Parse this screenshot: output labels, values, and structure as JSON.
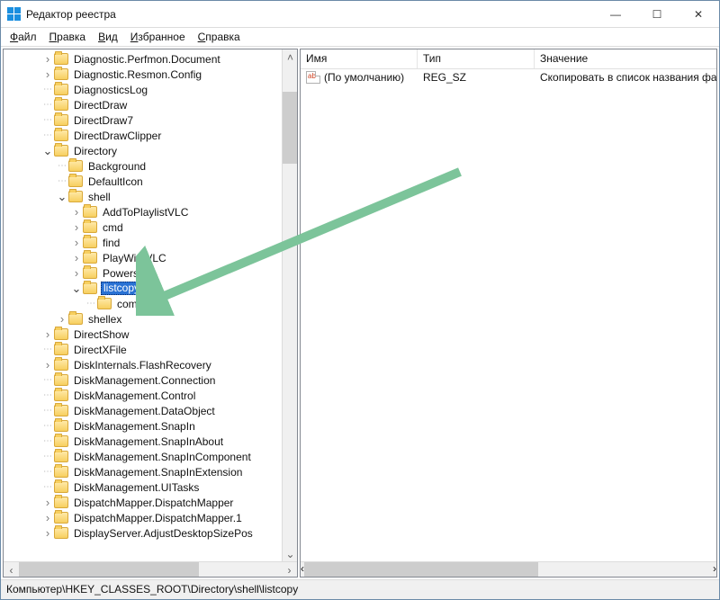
{
  "window": {
    "title": "Редактор реестра",
    "controls": {
      "min": "—",
      "max": "☐",
      "close": "✕"
    }
  },
  "menu": {
    "file": {
      "ul": "Ф",
      "rest": "айл"
    },
    "edit": {
      "ul": "П",
      "rest": "равка"
    },
    "view": {
      "ul": "В",
      "rest": "ид"
    },
    "fav": {
      "ul": "И",
      "rest": "збранное"
    },
    "help": {
      "ul": "С",
      "rest": "правка"
    }
  },
  "tree": {
    "items": [
      {
        "depth": 2,
        "arrow": "›",
        "label": "Diagnostic.Perfmon.Document"
      },
      {
        "depth": 2,
        "arrow": "›",
        "label": "Diagnostic.Resmon.Config"
      },
      {
        "depth": 2,
        "arrow": "",
        "label": "DiagnosticsLog"
      },
      {
        "depth": 2,
        "arrow": "",
        "label": "DirectDraw"
      },
      {
        "depth": 2,
        "arrow": "",
        "label": "DirectDraw7"
      },
      {
        "depth": 2,
        "arrow": "",
        "label": "DirectDrawClipper"
      },
      {
        "depth": 2,
        "arrow": "v",
        "label": "Directory"
      },
      {
        "depth": 3,
        "arrow": "",
        "label": "Background"
      },
      {
        "depth": 3,
        "arrow": "",
        "label": "DefaultIcon"
      },
      {
        "depth": 3,
        "arrow": "v",
        "label": "shell"
      },
      {
        "depth": 4,
        "arrow": "›",
        "label": "AddToPlaylistVLC"
      },
      {
        "depth": 4,
        "arrow": "›",
        "label": "cmd"
      },
      {
        "depth": 4,
        "arrow": "›",
        "label": "find"
      },
      {
        "depth": 4,
        "arrow": "›",
        "label": "PlayWithVLC"
      },
      {
        "depth": 4,
        "arrow": "›",
        "label": "Powershell"
      },
      {
        "depth": 4,
        "arrow": "v",
        "label": "listcopy",
        "selected": true
      },
      {
        "depth": 5,
        "arrow": "",
        "label": "command"
      },
      {
        "depth": 3,
        "arrow": "›",
        "label": "shellex"
      },
      {
        "depth": 2,
        "arrow": "›",
        "label": "DirectShow"
      },
      {
        "depth": 2,
        "arrow": "",
        "label": "DirectXFile"
      },
      {
        "depth": 2,
        "arrow": "›",
        "label": "DiskInternals.FlashRecovery"
      },
      {
        "depth": 2,
        "arrow": "",
        "label": "DiskManagement.Connection"
      },
      {
        "depth": 2,
        "arrow": "",
        "label": "DiskManagement.Control"
      },
      {
        "depth": 2,
        "arrow": "",
        "label": "DiskManagement.DataObject"
      },
      {
        "depth": 2,
        "arrow": "",
        "label": "DiskManagement.SnapIn"
      },
      {
        "depth": 2,
        "arrow": "",
        "label": "DiskManagement.SnapInAbout"
      },
      {
        "depth": 2,
        "arrow": "",
        "label": "DiskManagement.SnapInComponent"
      },
      {
        "depth": 2,
        "arrow": "",
        "label": "DiskManagement.SnapInExtension"
      },
      {
        "depth": 2,
        "arrow": "",
        "label": "DiskManagement.UITasks"
      },
      {
        "depth": 2,
        "arrow": "›",
        "label": "DispatchMapper.DispatchMapper"
      },
      {
        "depth": 2,
        "arrow": "›",
        "label": "DispatchMapper.DispatchMapper.1"
      },
      {
        "depth": 2,
        "arrow": "›",
        "label": "DisplayServer.AdjustDesktopSizePos"
      }
    ]
  },
  "list": {
    "columns": {
      "name": "Имя",
      "type": "Тип",
      "value": "Значение"
    },
    "colWidths": {
      "name": 130,
      "type": 130,
      "value": 200
    },
    "rows": [
      {
        "name": "(По умолчанию)",
        "type": "REG_SZ",
        "value": "Скопировать в список названия файлов"
      }
    ]
  },
  "statusbar": "Компьютер\\HKEY_CLASSES_ROOT\\Directory\\shell\\listcopy",
  "glyphs": {
    "right": "›",
    "down": "⌄",
    "left": "‹",
    "up": "˄",
    "dots": "⋯"
  }
}
